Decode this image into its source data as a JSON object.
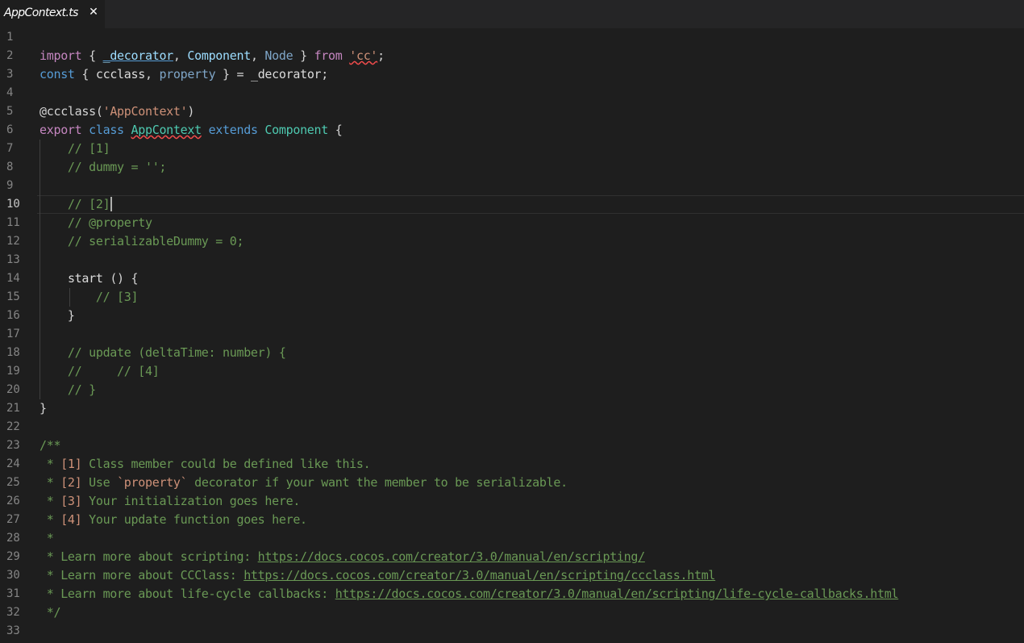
{
  "tab": {
    "title": "AppContext.ts",
    "close_glyph": "✕"
  },
  "lines": [
    "1",
    "2",
    "3",
    "4",
    "5",
    "6",
    "7",
    "8",
    "9",
    "10",
    "11",
    "12",
    "13",
    "14",
    "15",
    "16",
    "17",
    "18",
    "19",
    "20",
    "21",
    "22",
    "23",
    "24",
    "25",
    "26",
    "27",
    "28",
    "29",
    "30",
    "31",
    "32",
    "33"
  ],
  "code": {
    "l2": {
      "import": "import",
      "open": " { ",
      "decorator": "_decorator",
      "c1": ", ",
      "component": "Component",
      "c2": ", ",
      "node": "Node",
      "close": " } ",
      "from": "from",
      "sp": " ",
      "cc": "'cc'",
      "semi": ";"
    },
    "l3": {
      "const": "const",
      "open": " { ",
      "ccclass": "ccclass",
      "c1": ", ",
      "property": "property",
      "close": " } = ",
      "decorator": "_decorator",
      "semi": ";"
    },
    "l5": {
      "deco": "@ccclass",
      "open": "(",
      "name": "'AppContext'",
      "close": ")"
    },
    "l6": {
      "export": "export",
      "class": "class",
      "name": "AppContext",
      "extends": "extends",
      "base": "Component",
      "brace": "{"
    },
    "l7": "    // [1]",
    "l8": "    // dummy = '';",
    "l10": "    // [2]",
    "l11": "    // @property",
    "l12": "    // serializableDummy = 0;",
    "l14": {
      "indent": "    ",
      "start": "start",
      "rest": " () {"
    },
    "l15": "        // [3]",
    "l16": "    }",
    "l18": "    // update (deltaTime: number) {",
    "l19": "    //     // [4]",
    "l20": "    // }",
    "l21": "}",
    "l23": "/**",
    "l24": {
      "pre": " * ",
      "tag": "[1]",
      "text": " Class member could be defined like this."
    },
    "l25": {
      "pre": " * ",
      "tag": "[2]",
      "text1": " Use ",
      "code": "`property`",
      "text2": " decorator if your want the member to be serializable."
    },
    "l26": {
      "pre": " * ",
      "tag": "[3]",
      "text": " Your initialization goes here."
    },
    "l27": {
      "pre": " * ",
      "tag": "[4]",
      "text": " Your update function goes here."
    },
    "l28": " *",
    "l29": {
      "text": " * Learn more about scripting: ",
      "url": "https://docs.cocos.com/creator/3.0/manual/en/scripting/"
    },
    "l30": {
      "text": " * Learn more about CCClass: ",
      "url": "https://docs.cocos.com/creator/3.0/manual/en/scripting/ccclass.html"
    },
    "l31": {
      "text": " * Learn more about life-cycle callbacks: ",
      "url": "https://docs.cocos.com/creator/3.0/manual/en/scripting/life-cycle-callbacks.html"
    },
    "l32": " */"
  },
  "colors": {
    "background": "#1e1e1e",
    "keyword": "#569cd6",
    "control": "#c586c0",
    "type": "#4ec9b0",
    "variable": "#9cdcfe",
    "function": "#dcdcaa",
    "string": "#ce9178",
    "comment": "#6a9955",
    "error": "#f14c4c"
  },
  "cursor": {
    "line": "10"
  }
}
